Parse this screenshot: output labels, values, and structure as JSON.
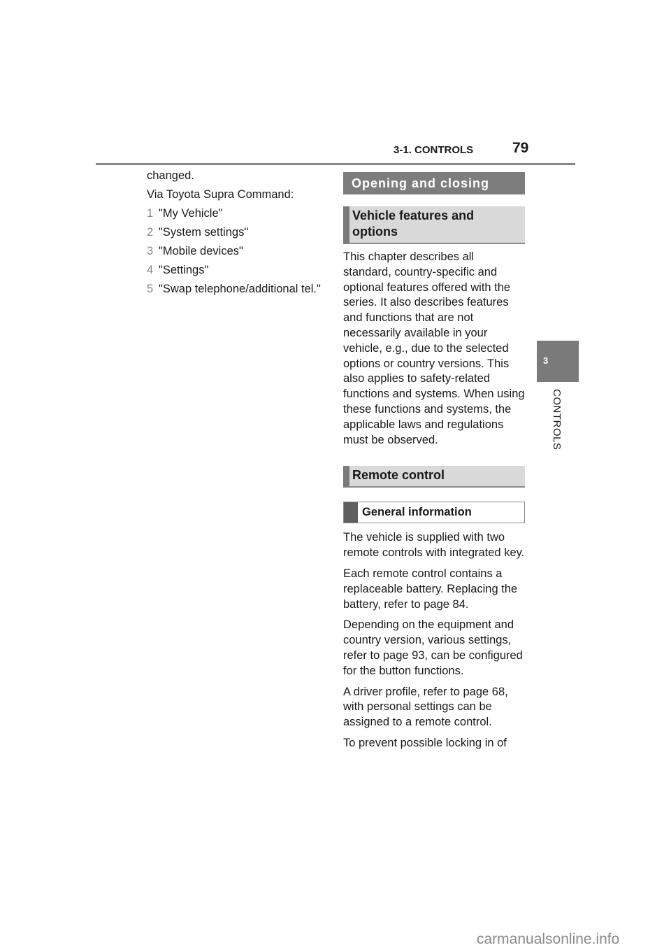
{
  "header": {
    "section_title": "3-1. CONTROLS",
    "page_number": "79"
  },
  "side_tab": {
    "chapter_number": "3",
    "chapter_label": "CONTROLS"
  },
  "left_column": {
    "intro_text": "changed.",
    "via_text": "Via Toyota Supra Command:",
    "steps": [
      {
        "num": "1",
        "text": "\"My Vehicle\""
      },
      {
        "num": "2",
        "text": "\"System settings\""
      },
      {
        "num": "3",
        "text": "\"Mobile devices\""
      },
      {
        "num": "4",
        "text": "\"Settings\""
      },
      {
        "num": "5",
        "text": "\"Swap telephone/additional tel.\""
      }
    ]
  },
  "right_column": {
    "chapter_heading": "Opening and closing",
    "section1_heading": "Vehicle features and options",
    "section1_text": "This chapter describes all standard, country-specific and optional features offered with the series. It also describes features and functions that are not necessarily available in your vehicle, e.g., due to the selected options or country versions. This also applies to safety-related functions and systems. When using these functions and systems, the applicable laws and regulations must be observed.",
    "section2_heading": "Remote control",
    "subsection_heading": "General information",
    "paragraphs": [
      "The vehicle is supplied with two remote controls with integrated key.",
      "Each remote control contains a replaceable battery. Replacing the battery, refer to page 84.",
      "Depending on the equipment and country version, various settings, refer to page 93, can be configured for the button functions.",
      "A driver profile, refer to page 68, with personal settings can be assigned to a remote control.",
      "To prevent possible locking in of"
    ]
  },
  "watermark": "carmanualsonline.info"
}
